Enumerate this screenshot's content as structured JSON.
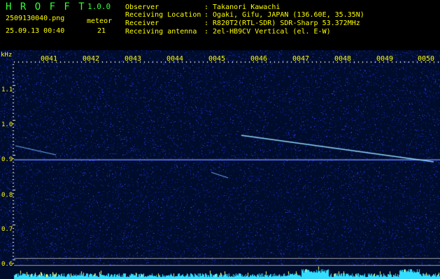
{
  "header": {
    "app_name": "H R O F F T",
    "version": "1.0.0",
    "filename": "2509130040.png",
    "datetime": "25.09.13 00:40",
    "meteor_label": "meteor",
    "meteor_count": "21",
    "info": [
      {
        "label": "Observer",
        "value": ": Takanori Kawachi"
      },
      {
        "label": "Receiving Location",
        "value": ": Ogaki, Gifu, JAPAN (136.60E, 35.35N)"
      },
      {
        "label": "Receiver",
        "value": ": R820T2(RTL-SDR) SDR-Sharp 53.372MHz"
      },
      {
        "label": "Receiving antenna",
        "value": ": 2el-HB9CV Vertical (el. E-W)"
      }
    ]
  },
  "spectrogram": {
    "unit_label": "kHz",
    "time_labels": [
      "0041",
      "0042",
      "0043",
      "0044",
      "0045",
      "0046",
      "0047",
      "0048",
      "0049",
      "0050"
    ],
    "freq_labels": [
      "1.1",
      "1.0",
      "0.9",
      "0.8",
      "0.7",
      "0.6"
    ],
    "colors": {
      "background": "#000c2c",
      "noise": "#1a2fd0",
      "trace": "#8fd8ff",
      "label": "#ffff00",
      "level": "#33ddff"
    }
  }
}
